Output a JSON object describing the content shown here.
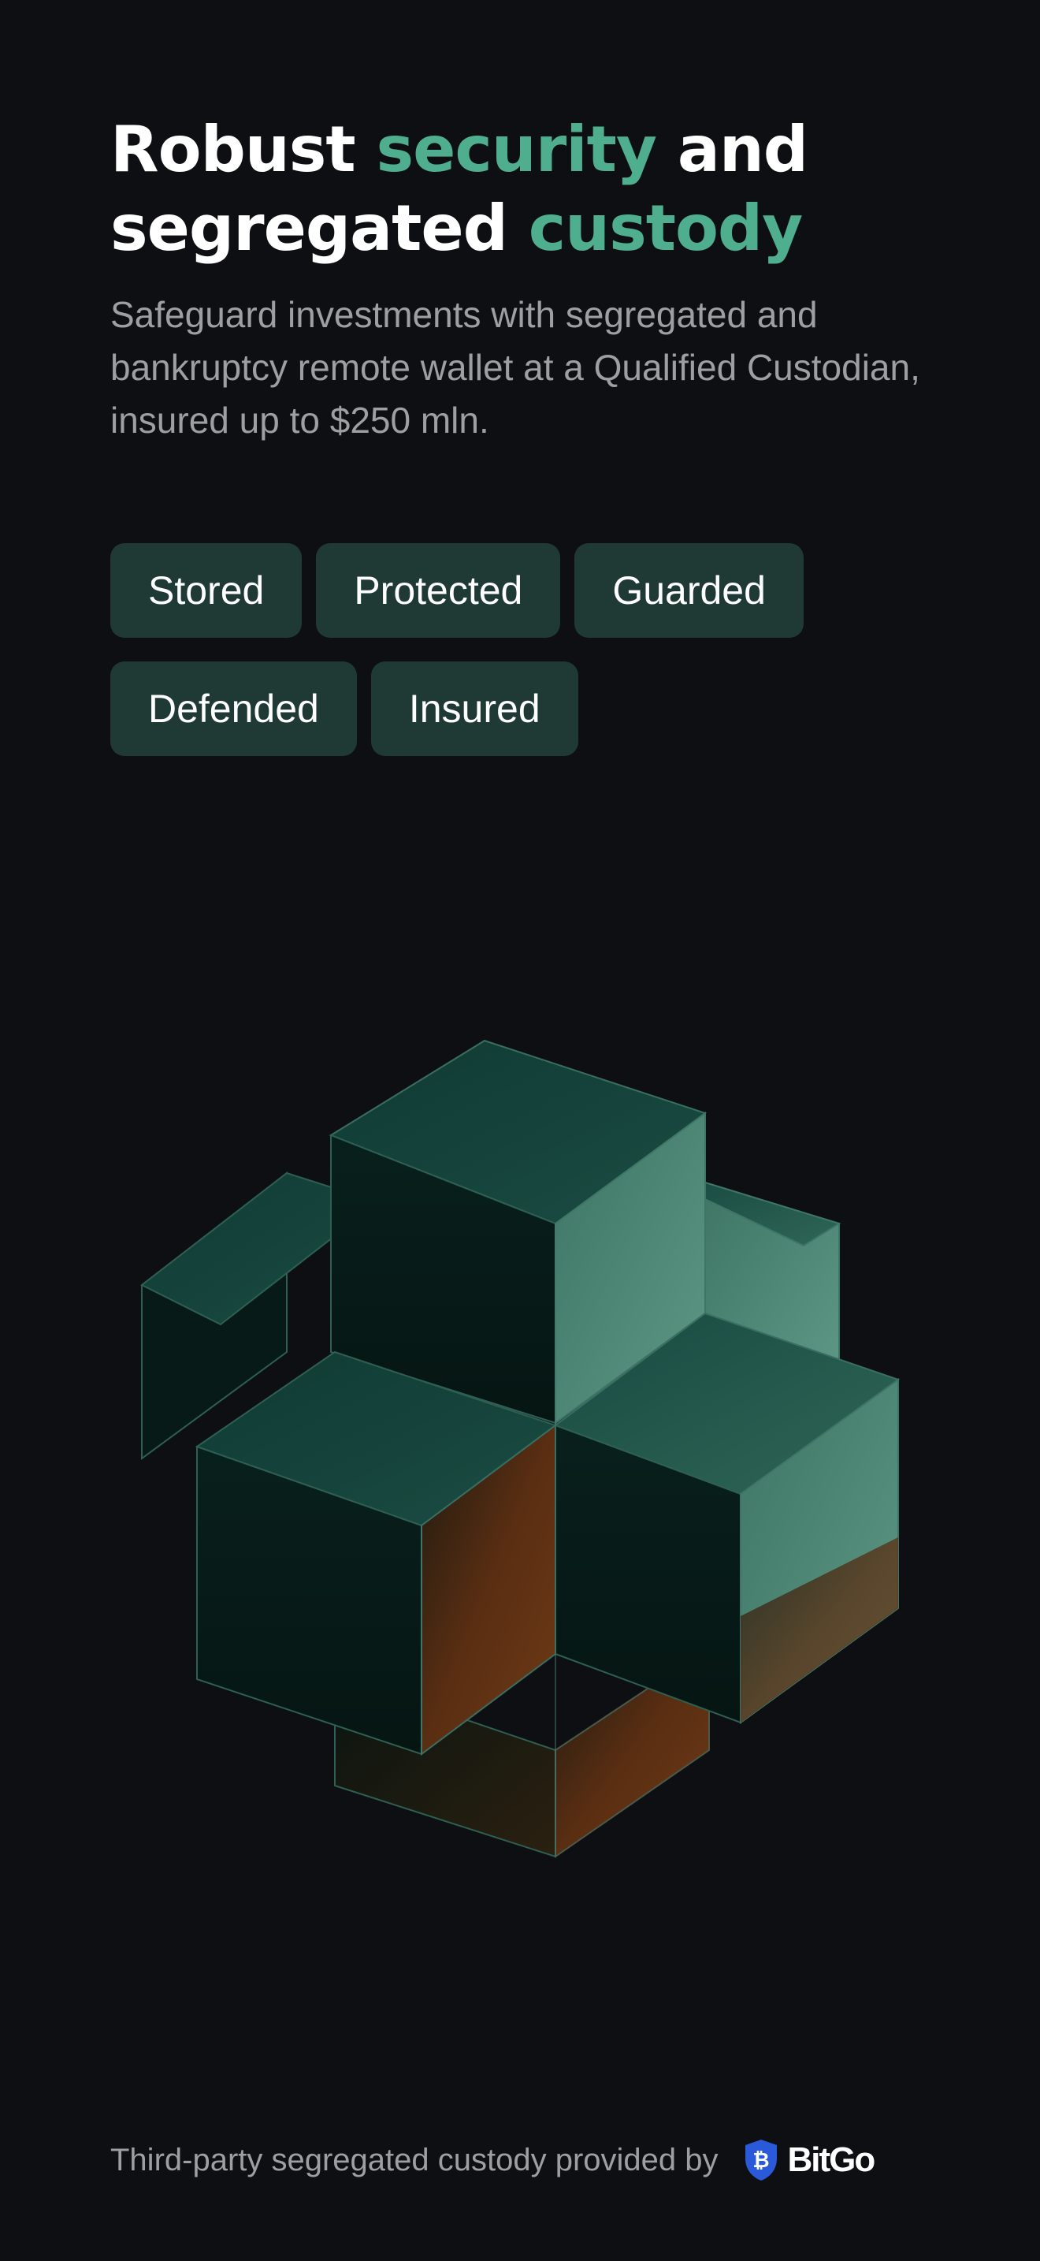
{
  "headline": {
    "part1": "Robust ",
    "accent1": "security",
    "part2": " and",
    "part3": "segregated ",
    "accent2": "custody"
  },
  "subtitle": "Safeguard investments with segregated and bankruptcy remote wallet at a Qualified Custodian, insured up to $250 mln.",
  "chips": [
    "Stored",
    "Protected",
    "Guarded",
    "Defended",
    "Insured"
  ],
  "illustration": {
    "icon": "cube-cluster-illustration"
  },
  "footer": {
    "text": "Third-party segregated custody provided by",
    "brand": "BitGo",
    "brand_icon": "bitgo-shield-logo"
  },
  "colors": {
    "background": "#0e0f12",
    "accent": "#4fae8d",
    "chip_background": "#1f3a34",
    "muted_text": "#9d9fa5",
    "brand_blue": "#2a5ada"
  }
}
